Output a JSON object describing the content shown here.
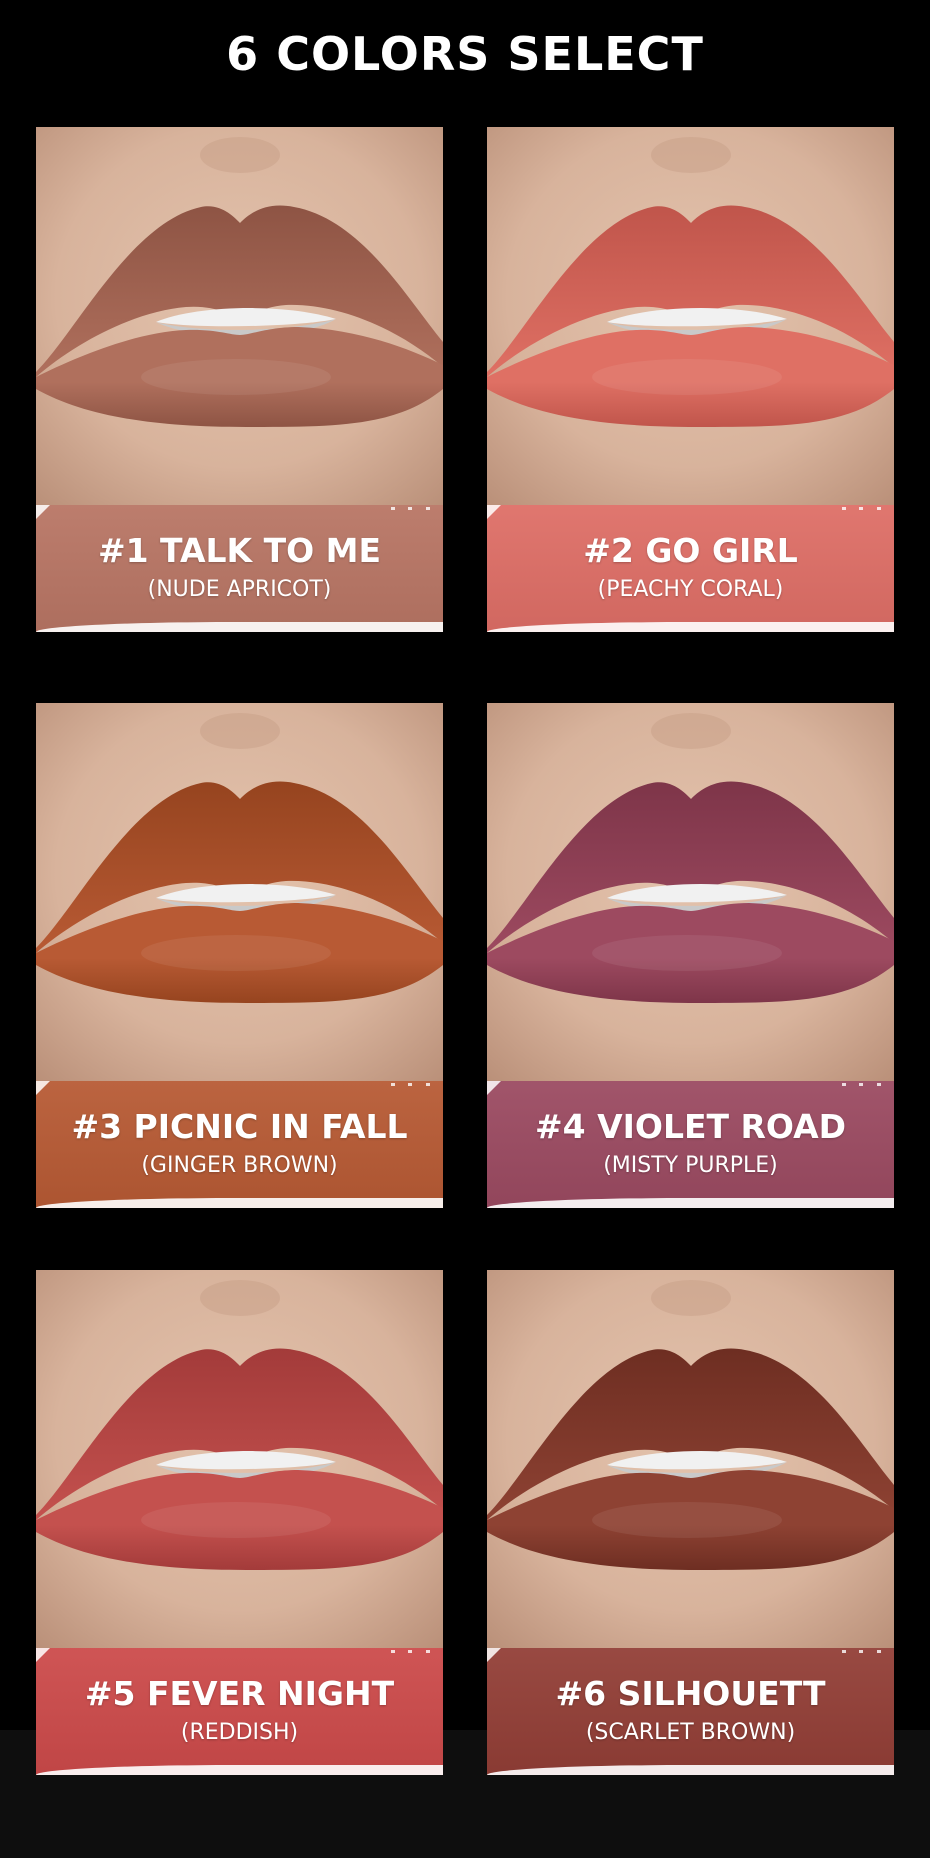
{
  "title": "6 COLORS SELECT",
  "colors": {
    "background": "#000000",
    "text": "#ffffff",
    "skin": "#d8b39c"
  },
  "shades": [
    {
      "name": "#1 TALK TO ME",
      "description": "(NUDE APRICOT)",
      "lip_color": "#b0705d",
      "lip_dark": "#8e5444",
      "band_color": "#b87564"
    },
    {
      "name": "#2 GO GIRL",
      "description": "(PEACHY CORAL)",
      "lip_color": "#df7064",
      "lip_dark": "#c0554b",
      "band_color": "#de6e66"
    },
    {
      "name": "#3 PICNIC IN FALL",
      "description": "(GINGER BROWN)",
      "lip_color": "#b85a34",
      "lip_dark": "#96441f",
      "band_color": "#b75a34"
    },
    {
      "name": "#4 VIOLET ROAD",
      "description": "(MISTY PURPLE)",
      "lip_color": "#9d4a60",
      "lip_dark": "#7e3549",
      "band_color": "#9b4a61"
    },
    {
      "name": "#5 FEVER NIGHT",
      "description": "(REDDISH)",
      "lip_color": "#c4514e",
      "lip_dark": "#a33b3a",
      "band_color": "#cc4a4a"
    },
    {
      "name": "#6 SILHOUETT",
      "description": "(SCARLET BROWN)",
      "lip_color": "#8e4233",
      "lip_dark": "#6e2e22",
      "band_color": "#923e36"
    }
  ]
}
